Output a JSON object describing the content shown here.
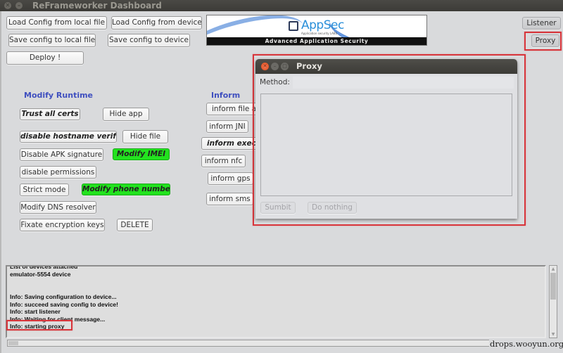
{
  "window": {
    "title": "ReFrameworker Dashboard",
    "controls": [
      "close",
      "minimize"
    ]
  },
  "toolbar": {
    "load_local": "Load Config from local file",
    "load_device": "Load Config from device",
    "save_local": "Save config to local file",
    "save_device": "Save config to device",
    "deploy": "Deploy !"
  },
  "banner": {
    "logo": "AppSec",
    "logo_sub": "Application security LABS",
    "tagline": "Advanced Application Security"
  },
  "right_buttons": {
    "listener": "Listener",
    "proxy": "Proxy"
  },
  "modify_runtime": {
    "heading": "Modify Runtime",
    "trust_all_certs": "Trust all certs",
    "hide_app": "Hide app",
    "disable_hostname_verify": "disable hostname verify",
    "hide_file": "Hide file",
    "disable_apk_signature": "Disable APK signature",
    "modify_imei": "Modify IMEI",
    "disable_permissions": "disable permissions",
    "strict_mode": "Strict mode",
    "modify_phone_number": "Modify phone number",
    "modify_dns_resolver": "Modify DNS resolver",
    "fixate_encryption_keys": "Fixate encryption keys",
    "delete": "DELETE"
  },
  "inform": {
    "heading": "Inform",
    "file_access": "inform file access",
    "jni": "inform JNI",
    "exec_process": "inform exec process",
    "nfc": "inform nfc",
    "gps": "inform gps",
    "sms": "inform sms"
  },
  "colors": {
    "active_green": "#22e21e",
    "section_blue": "#3f4fbf",
    "highlight_red": "#d8353b"
  },
  "proxy_dialog": {
    "title": "Proxy",
    "method_label": "Method:",
    "method_value": "",
    "body_value": "",
    "submit": "Sumbit",
    "do_nothing": "Do nothing"
  },
  "console": {
    "lines": [
      "List of devices attached",
      "emulator-5554   device",
      "",
      "",
      "Info: Saving configuration to device...",
      "Info: succeed saving config to device!",
      "Info: start listener",
      "Info: Waiting for client message...",
      "Info: starting proxy"
    ]
  },
  "watermark": "drops.wooyun.org"
}
